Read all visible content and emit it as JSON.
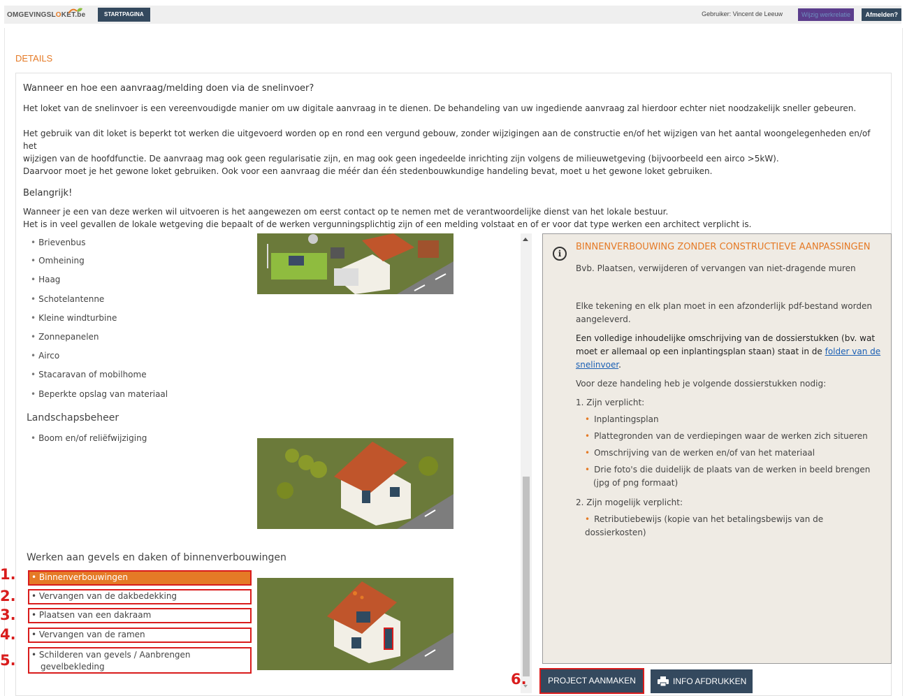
{
  "header": {
    "logo_part1": "OMGEVINGSL",
    "logo_part2": "O",
    "logo_part3": "KET",
    "logo_part4": ".be",
    "start_label": "STARTPAGINA",
    "user_label": "Gebruiker: Vincent de Leeuw",
    "wijzig_label": "Wijzig werkrelatie",
    "logout_label": "Afmelden?"
  },
  "page": {
    "title": "DETAILS"
  },
  "intro": {
    "heading": "Wanneer en hoe een aanvraag/melding doen via de snelinvoer?",
    "p1": "Het loket van de snelinvoer is een vereenvoudigde manier om uw digitale aanvraag in te dienen. De behandeling van uw ingediende aanvraag zal hierdoor echter niet noodzakelijk sneller gebeuren.",
    "p2a": "Het gebruik van dit loket is beperkt tot werken die uitgevoerd worden op en rond een vergund gebouw, zonder wijzigingen aan de constructie en/of het wijzigen van het aantal woongelegenheden en/of het",
    "p2b": "wijzigen van de hoofdfunctie. De aanvraag mag ook geen regularisatie zijn, en mag ook geen ingedeelde inrichting zijn volgens de milieuwetgeving (bijvoorbeeld een airco >5kW).",
    "p2c": "Daarvoor moet je het gewone loket gebruiken. Ook voor een aanvraag die méér dan één stedenbouwkundige handeling bevat, moet u het gewone loket gebruiken.",
    "important_heading": "Belangrijk!",
    "p3a": "Wanneer je een van deze werken wil uitvoeren is het aangewezen om eerst contact op te nemen met de verantwoordelijke dienst van het lokale bestuur.",
    "p3b": "Het is in veel gevallen de lokale wetgeving die bepaalt of de werken vergunningsplichtig zijn of een melding volstaat en of er voor dat type werken een architect verplicht is."
  },
  "work_list": {
    "outdoor_items": [
      "Brievenbus",
      "Omheining",
      "Haag",
      "Schotelantenne",
      "Kleine windturbine",
      "Zonnepanelen",
      "Airco",
      "Stacaravan of mobilhome",
      "Beperkte opslag van materiaal"
    ],
    "landscape_title": "Landschapsbeheer",
    "landscape_items": [
      "Boom en/of reliëfwijziging"
    ],
    "facade_title": "Werken aan gevels en daken of binnenverbouwingen",
    "facade_items": [
      "Binnenverbouwingen",
      "Vervangen van de dakbedekking",
      "Plaatsen van een dakraam",
      "Vervangen van de ramen",
      "Schilderen van gevels / Aanbrengen gevelbekleding"
    ],
    "facade_item5_line1": "Schilderen van gevels / Aanbrengen",
    "facade_item5_line2": "gevelbekleding"
  },
  "annotations": [
    "1.",
    "2.",
    "3.",
    "4.",
    "5.",
    "6."
  ],
  "info": {
    "title": "BINNENVERBOUWING ZONDER CONSTRUCTIEVE AANPASSINGEN",
    "example": "Bvb. Plaatsen, verwijderen of vervangen van niet-dragende muren",
    "drawing_note_a": "Elke tekening en elk plan moet in een afzonderlijk pdf-bestand worden",
    "drawing_note_b": "aangeleverd.",
    "desc_a": "Een volledige inhoudelijke omschrijving van de dossierstukken (bv. wat",
    "desc_b": "moet er allemaal op een inplantingsplan staan) staat in de",
    "desc_link_a": "folder van de",
    "desc_link_b": "snelinvoer",
    "desc_end": ".",
    "needed": "Voor deze handeling heb je volgende dossierstukken nodig:",
    "required_heading": "1. Zijn verplicht:",
    "required_items": [
      "Inplantingsplan",
      "Plattegronden van de verdiepingen waar de werken zich situeren",
      "Omschrijving van de werken en/of van het materiaal",
      "Drie foto's die duidelijk de plaats van de werken in beeld brengen",
      "(jpg of png formaat)"
    ],
    "optional_heading": "2. Zijn mogelijk verplicht:",
    "optional_items": [
      "Retributiebewijs (kopie van het betalingsbewijs van de dossierkosten)"
    ]
  },
  "actions": {
    "create_label": "PROJECT AANMAKEN",
    "print_label": "INFO AFDRUKKEN"
  },
  "colors": {
    "accent": "#e57a26",
    "navy": "#34495e",
    "highlight_border": "#d91c1c",
    "info_bg": "#efebe4"
  }
}
